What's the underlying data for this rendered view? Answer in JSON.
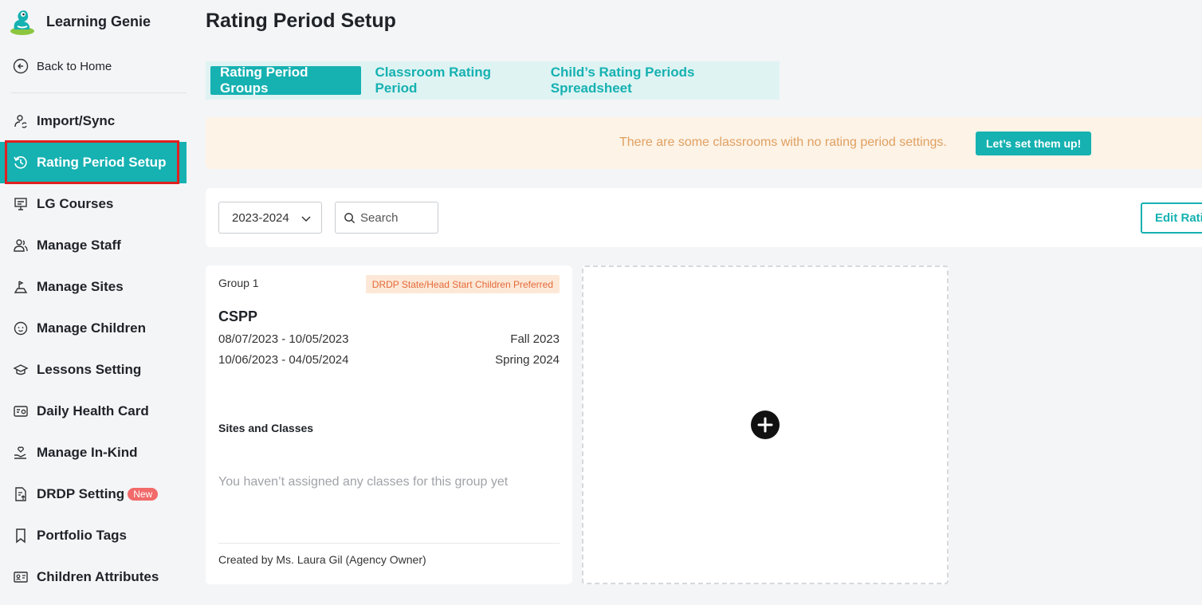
{
  "app": {
    "name": "Learning Genie"
  },
  "sidebar": {
    "back_label": "Back to Home",
    "items": [
      {
        "label": "Import/Sync",
        "icon": "sync-person-icon"
      },
      {
        "label": "Rating Period Setup",
        "icon": "clock-rotate-icon",
        "active": true
      },
      {
        "label": "LG Courses",
        "icon": "presentation-icon"
      },
      {
        "label": "Manage Staff",
        "icon": "users-icon"
      },
      {
        "label": "Manage Sites",
        "icon": "sites-icon"
      },
      {
        "label": "Manage Children",
        "icon": "child-face-icon"
      },
      {
        "label": "Lessons Setting",
        "icon": "graduation-cap-icon"
      },
      {
        "label": "Daily Health Card",
        "icon": "health-card-icon"
      },
      {
        "label": "Manage In-Kind",
        "icon": "hand-heart-icon"
      },
      {
        "label": "DRDP Setting",
        "icon": "document-upload-icon",
        "badge": "New"
      },
      {
        "label": "Portfolio Tags",
        "icon": "bookmark-icon"
      },
      {
        "label": "Children Attributes",
        "icon": "id-card-icon"
      }
    ]
  },
  "page": {
    "title": "Rating Period Setup"
  },
  "tabs": [
    {
      "label": "Rating Period Groups",
      "active": true
    },
    {
      "label": "Classroom Rating Period"
    },
    {
      "label": "Child’s Rating Periods Spreadsheet"
    }
  ],
  "alert": {
    "message": "There are some classrooms with no rating period settings.",
    "button": "Let’s set them up!"
  },
  "filters": {
    "year": "2023-2024",
    "search_placeholder": "Search",
    "edit_button": "Edit Rating"
  },
  "group_card": {
    "group": "Group 1",
    "tag": "DRDP State/Head Start Children Preferred",
    "title": "CSPP",
    "periods": [
      {
        "range": "08/07/2023 - 10/05/2023",
        "name": "Fall 2023"
      },
      {
        "range": "10/06/2023 - 04/05/2024",
        "name": "Spring 2024"
      }
    ],
    "sites_title": "Sites and Classes",
    "empty_text": "You haven’t assigned any classes for this group yet",
    "creator": "Created by Ms. Laura Gil (Agency Owner)"
  },
  "colors": {
    "accent": "#16b1b1",
    "alert_bg": "#fdf3e7",
    "alert_text": "#e0a060",
    "badge": "#f26a6a",
    "highlight": "#e02020"
  }
}
